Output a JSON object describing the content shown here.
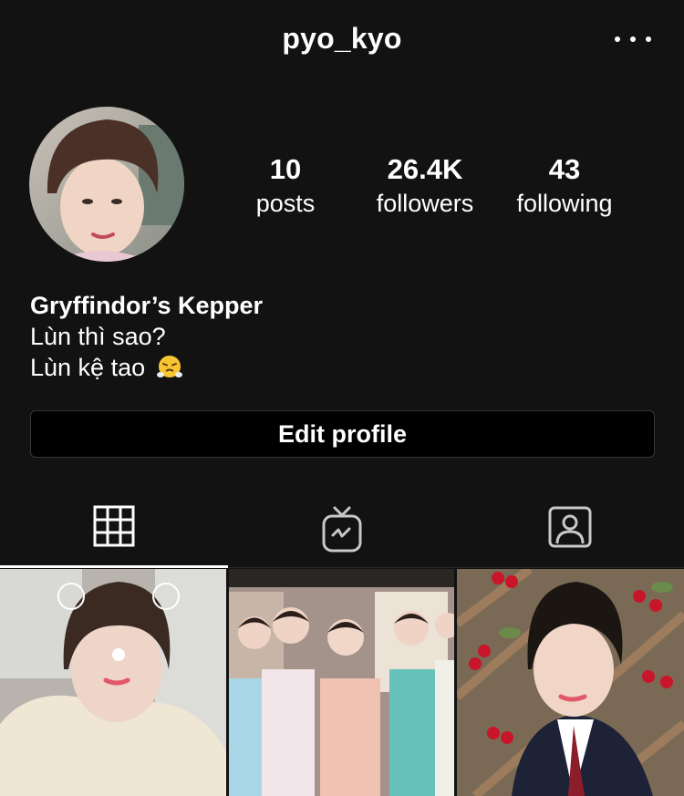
{
  "header": {
    "username": "pyo_kyo",
    "menu_icon": "more-horizontal-icon"
  },
  "profile": {
    "stats": [
      {
        "value": "10",
        "label": "posts"
      },
      {
        "value": "26.4K",
        "label": "followers"
      },
      {
        "value": "43",
        "label": "following"
      }
    ],
    "display_name": "Gryffindor’s Kepper",
    "bio_line_1": "Lùn thì sao?",
    "bio_line_2": "Lùn kệ tao",
    "bio_emoji": "face-with-steam-from-nose"
  },
  "edit_button": {
    "label": "Edit profile"
  },
  "tabs": [
    {
      "icon": "grid-icon",
      "active": true
    },
    {
      "icon": "igtv-icon",
      "active": false
    },
    {
      "icon": "tagged-icon",
      "active": false
    }
  ],
  "posts": [
    {
      "thumbnail": "selfie with cloud-ear filter"
    },
    {
      "thumbnail": "group photo of five boys"
    },
    {
      "thumbnail": "selfie in school uniform with cherries"
    }
  ],
  "colors": {
    "background": "#121212",
    "text": "#ffffff",
    "button_border": "#363636",
    "button_bg": "#000000"
  }
}
